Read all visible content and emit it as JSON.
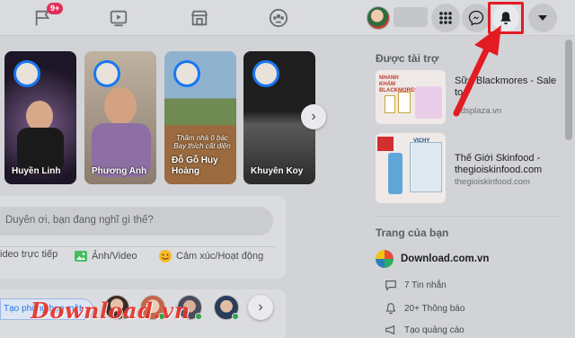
{
  "topbar": {
    "notification_count": "9+",
    "icons": [
      "pages-icon",
      "watch-icon",
      "marketplace-icon",
      "groups-icon",
      "menu-grid-icon",
      "messenger-icon",
      "notification-bell-icon",
      "account-caret-icon"
    ]
  },
  "stories": [
    {
      "name": "Huyền Linh"
    },
    {
      "name": "Phương Anh"
    },
    {
      "name": "Đỗ Gỗ Huy Hoàng",
      "overlay": "Thâm nhà ô bác\nBay thích cất diện"
    },
    {
      "name": "Khuyên Koy"
    }
  ],
  "composer": {
    "placeholder": "Duyên ơi, bạn đang nghĩ gì thế?",
    "actions": [
      "ideo trực tiếp",
      "Ảnh/Video",
      "Cảm xúc/Hoạt động"
    ]
  },
  "rooms": {
    "create_label": "Tạo phòng họp mặt"
  },
  "watermark": "Download.vn",
  "sponsored": {
    "title": "Được tài trợ",
    "ads": [
      {
        "title": "Sữa Blackmores - Sale to",
        "domain": "kidsplaza.vn",
        "image_text": "NHANH KHÁM BLACKMORES"
      },
      {
        "title": "Thế Giới Skinfood - thegioiskinfood.com",
        "domain": "thegioiskinfood.com",
        "image_text": "VICHY"
      }
    ]
  },
  "your_pages": {
    "title": "Trang của bạn",
    "page_name": "Download.com.vn",
    "items": [
      "7 Tin nhắn",
      "20+ Thông báo",
      "Tạo quảng cáo"
    ]
  },
  "colors": {
    "accent": "#1877f2",
    "highlight_red": "#e31b23",
    "badge": "#e0305a"
  }
}
